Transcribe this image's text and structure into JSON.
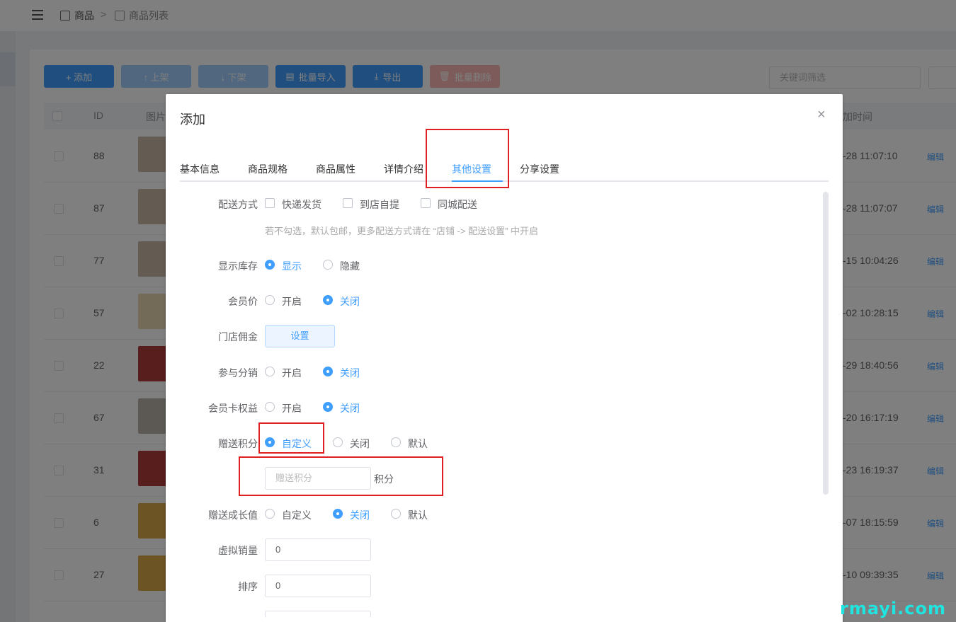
{
  "breadcrumb": {
    "root": "商品",
    "separator": ">",
    "current": "商品列表"
  },
  "toolbar": {
    "add": "+ 添加",
    "up": "↑ 上架",
    "down": "↓ 下架",
    "import": "批量导入",
    "export": "导出",
    "delete": "批量删除",
    "keyword_placeholder": "关键词筛选"
  },
  "table": {
    "headers": {
      "id": "ID",
      "image": "图片",
      "time": "加时间"
    },
    "rows": [
      {
        "id": "88",
        "time": "-28 11:07:10",
        "edit": "编辑"
      },
      {
        "id": "87",
        "time": "-28 11:07:07",
        "edit": "编辑"
      },
      {
        "id": "77",
        "time": "-15 10:04:26",
        "edit": "编辑"
      },
      {
        "id": "57",
        "time": "-02 10:28:15",
        "edit": "编辑"
      },
      {
        "id": "22",
        "time": "-29 18:40:56",
        "edit": "编辑"
      },
      {
        "id": "67",
        "time": "-20 16:17:19",
        "edit": "编辑"
      },
      {
        "id": "31",
        "time": "-23 16:19:37",
        "edit": "编辑"
      },
      {
        "id": "6",
        "time": "-07 18:15:59",
        "edit": "编辑"
      },
      {
        "id": "27",
        "time": "-10 09:39:35",
        "edit": "编辑"
      }
    ]
  },
  "dialog": {
    "title": "添加",
    "close": "×",
    "tabs": [
      "基本信息",
      "商品规格",
      "商品属性",
      "详情介绍",
      "其他设置",
      "分享设置"
    ],
    "active_tab": "其他设置",
    "delivery": {
      "label": "配送方式",
      "options": [
        "快递发货",
        "到店自提",
        "同城配送"
      ],
      "hint": "若不勾选，默认包邮，更多配送方式请在 “店铺 -> 配送设置” 中开启"
    },
    "stock": {
      "label": "显示库存",
      "options": [
        "显示",
        "隐藏"
      ],
      "selected": "显示"
    },
    "member_price": {
      "label": "会员价",
      "options": [
        "开启",
        "关闭"
      ],
      "selected": "关闭"
    },
    "store_commission": {
      "label": "门店佣金",
      "button": "设置"
    },
    "distribution": {
      "label": "参与分销",
      "options": [
        "开启",
        "关闭"
      ],
      "selected": "关闭"
    },
    "card_rights": {
      "label": "会员卡权益",
      "options": [
        "开启",
        "关闭"
      ],
      "selected": "关闭"
    },
    "points": {
      "label": "赠送积分",
      "options": [
        "自定义",
        "关闭",
        "默认"
      ],
      "selected": "自定义",
      "placeholder": "赠送积分",
      "unit": "积分"
    },
    "growth": {
      "label": "赠送成长值",
      "options": [
        "自定义",
        "关闭",
        "默认"
      ],
      "selected": "关闭"
    },
    "virtual_sales": {
      "label": "虚拟销量",
      "value": "0"
    },
    "sort": {
      "label": "排序",
      "value": "0"
    }
  },
  "watermark": "rmayi.com",
  "colors": {
    "primary": "#409eff",
    "highlight": "#e02020"
  }
}
